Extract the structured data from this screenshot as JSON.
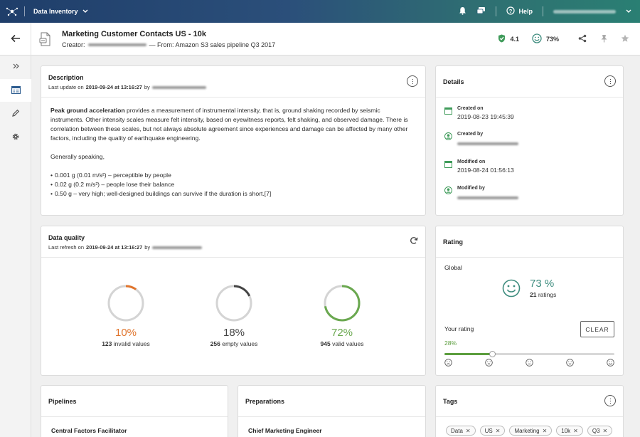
{
  "topbar": {
    "app_name": "Data Inventory",
    "help_label": "Help"
  },
  "header": {
    "title": "Marketing Customer Contacts US - 10k",
    "creator_label": "Creator:",
    "from_text": "— From: Amazon S3 sales pipeline Q3 2017",
    "trust_score": "4.1",
    "rating_percent": "73%"
  },
  "description": {
    "title": "Description",
    "last_update_prefix": "Last update on",
    "last_update_date": "2019-09-24 at 13:16:27",
    "by": "by",
    "bold_lead": "Peak ground acceleration",
    "paragraph": " provides a measurement of instrumental intensity, that is, ground shaking recorded by seismic instruments. Other intensity scales measure felt intensity, based on eyewitness reports, felt shaking, and observed damage. There is correlation between these scales, but not always absolute agreement since experiences and damage can be affected by many other factors, including the quality of earthquake engineering.",
    "generally": "Generally speaking,",
    "bullets": [
      "0.001 g (0.01 m/s²) – perceptible by people",
      "0.02  g (0.2  m/s²) – people lose their balance",
      "0.50  g – very high; well-designed buildings can survive if the duration is short.[7]"
    ]
  },
  "details": {
    "title": "Details",
    "created_on_label": "Created on",
    "created_on_value": "2019-08-23 19:45:39",
    "created_by_label": "Created by",
    "modified_on_label": "Modified on",
    "modified_on_value": "2019-08-24 01:56:13",
    "modified_by_label": "Modified by"
  },
  "data_quality": {
    "title": "Data quality",
    "last_refresh_prefix": "Last refresh on",
    "last_refresh_date": "2019-09-24 at 13:16:27",
    "by": "by",
    "items": [
      {
        "percent": "10%",
        "value": 0.1,
        "count": "123",
        "label": "invalid values",
        "color": "#e0742c"
      },
      {
        "percent": "18%",
        "value": 0.18,
        "count": "256",
        "label": "empty values",
        "color": "#444444"
      },
      {
        "percent": "72%",
        "value": 0.72,
        "count": "945",
        "label": "valid values",
        "color": "#6aa84f"
      }
    ]
  },
  "rating": {
    "title": "Rating",
    "global_label": "Global",
    "global_percent": "73 %",
    "ratings_count": "21",
    "ratings_label": "ratings",
    "your_rating_label": "Your rating",
    "clear_label": "CLEAR",
    "your_rating_percent": "28%",
    "your_rating_value": 0.28,
    "accent_color": "#3d8c7e"
  },
  "pipelines": {
    "title": "Pipelines",
    "first_item": "Central Factors Facilitator"
  },
  "preparations": {
    "title": "Preparations",
    "first_item": "Chief Marketing Engineer"
  },
  "tags": {
    "title": "Tags",
    "items": [
      "Data",
      "US",
      "Marketing",
      "10k",
      "Q3"
    ]
  }
}
